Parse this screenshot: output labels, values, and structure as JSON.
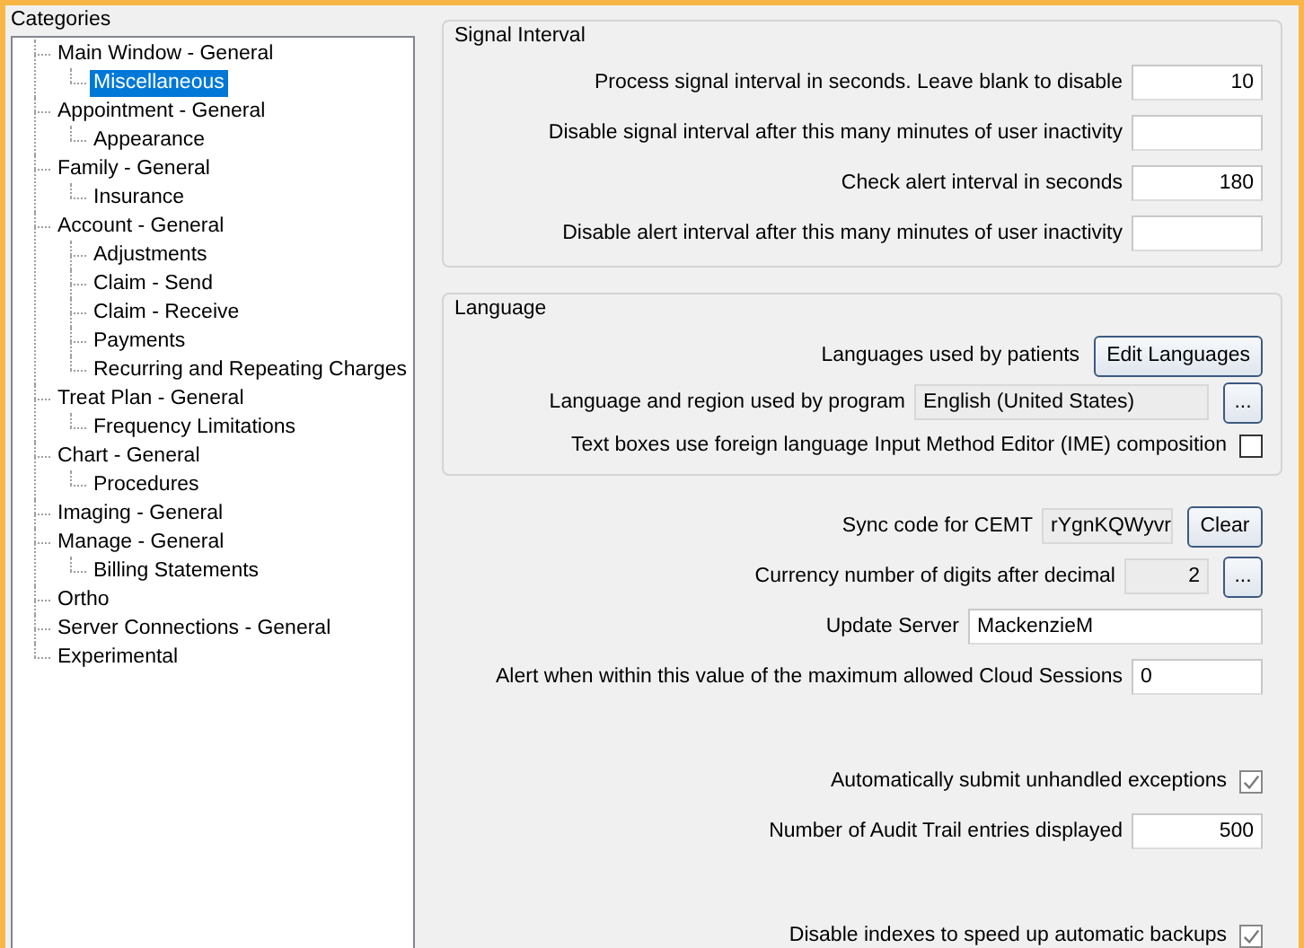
{
  "categories": {
    "title": "Categories",
    "items": [
      {
        "label": "Main Window - General",
        "selected": false,
        "children": [
          {
            "label": "Miscellaneous",
            "selected": true
          }
        ]
      },
      {
        "label": "Appointment - General",
        "selected": false,
        "children": [
          {
            "label": "Appearance",
            "selected": false
          }
        ]
      },
      {
        "label": "Family - General",
        "selected": false,
        "children": [
          {
            "label": "Insurance",
            "selected": false
          }
        ]
      },
      {
        "label": "Account - General",
        "selected": false,
        "children": [
          {
            "label": "Adjustments",
            "selected": false
          },
          {
            "label": "Claim - Send",
            "selected": false
          },
          {
            "label": "Claim - Receive",
            "selected": false
          },
          {
            "label": "Payments",
            "selected": false
          },
          {
            "label": "Recurring and Repeating Charges",
            "selected": false
          }
        ]
      },
      {
        "label": "Treat Plan - General",
        "selected": false,
        "children": [
          {
            "label": "Frequency Limitations",
            "selected": false
          }
        ]
      },
      {
        "label": "Chart - General",
        "selected": false,
        "children": [
          {
            "label": "Procedures",
            "selected": false
          }
        ]
      },
      {
        "label": "Imaging - General",
        "selected": false
      },
      {
        "label": "Manage - General",
        "selected": false,
        "children": [
          {
            "label": "Billing Statements",
            "selected": false
          }
        ]
      },
      {
        "label": "Ortho",
        "selected": false
      },
      {
        "label": "Server Connections - General",
        "selected": false
      },
      {
        "label": "Experimental",
        "selected": false
      }
    ]
  },
  "settings_groups": [
    {
      "title": "Signal Interval",
      "rows": [
        {
          "kind": "number",
          "label": "Process signal interval in seconds.  Leave blank to disable",
          "value": "10"
        },
        {
          "kind": "number",
          "label": "Disable signal interval after this many minutes of user inactivity"
        },
        {
          "kind": "number",
          "label": "Check alert interval in seconds",
          "value": "180"
        },
        {
          "kind": "number",
          "label": "Disable alert interval after this many minutes of user inactivity"
        }
      ]
    },
    {
      "title": "Language",
      "rows": [
        {
          "kind": "button",
          "label": "Languages used by patients",
          "button": "Edit Languages"
        },
        {
          "kind": "picker",
          "label": "Language and region used by program",
          "value": "English (United States)",
          "button": "..."
        },
        {
          "kind": "checkbox",
          "label": "Text boxes use foreign language Input Method Editor (IME) composition",
          "checked": false
        }
      ]
    },
    {
      "rows": [
        {
          "kind": "code",
          "label": "Sync code for CEMT",
          "value": "rYgnKQWyvr",
          "button": "Clear"
        },
        {
          "kind": "number-picker",
          "label": "Currency number of digits after decimal",
          "value": "2",
          "button": "..."
        },
        {
          "kind": "wide-text",
          "label": "Update Server",
          "value": "MackenzieM"
        },
        {
          "kind": "short-text",
          "label": "Alert when within this value of the maximum allowed Cloud Sessions",
          "value": "0"
        }
      ]
    },
    {
      "rows": [
        {
          "kind": "checkbox",
          "label": "Automatically submit unhandled exceptions",
          "checked": true
        },
        {
          "kind": "number",
          "label": "Number of Audit Trail entries displayed",
          "value": "500"
        }
      ]
    },
    {
      "rows": [
        {
          "kind": "checkbox",
          "label": "Disable indexes to speed up automatic backups",
          "checked": true
        }
      ]
    }
  ]
}
